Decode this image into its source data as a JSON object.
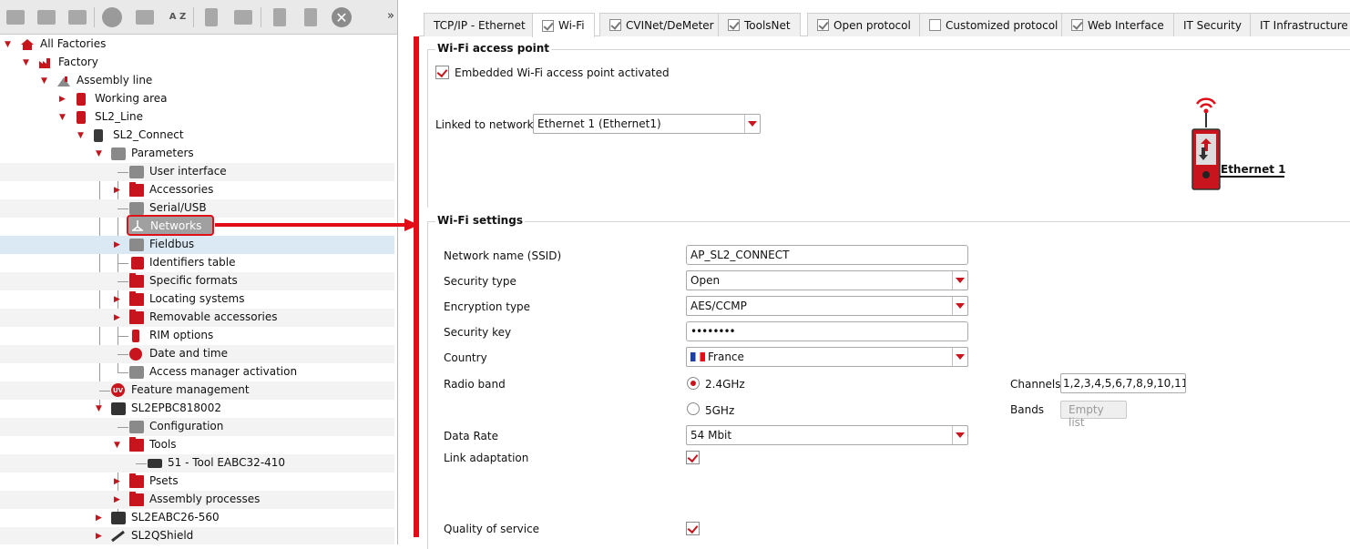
{
  "toolbar": {
    "more": "»",
    "icons": [
      "add-icon",
      "add-icon",
      "add-icon",
      "device-icon",
      "copy-device-icon",
      "sort-az-icon",
      "tool-icon",
      "export-icon",
      "copy-icon",
      "paste-icon",
      "delete-icon"
    ],
    "sort_label": "A Z"
  },
  "tree": {
    "items": [
      {
        "label": "All Factories"
      },
      {
        "label": "Factory"
      },
      {
        "label": "Assembly line"
      },
      {
        "label": "Working area"
      },
      {
        "label": "SL2_Line"
      },
      {
        "label": "SL2_Connect"
      },
      {
        "label": "Parameters"
      },
      {
        "label": "User interface"
      },
      {
        "label": "Accessories"
      },
      {
        "label": "Serial/USB"
      },
      {
        "label": "Networks"
      },
      {
        "label": "Fieldbus"
      },
      {
        "label": "Identifiers table"
      },
      {
        "label": "Specific formats"
      },
      {
        "label": "Locating systems"
      },
      {
        "label": "Removable accessories"
      },
      {
        "label": "RIM options"
      },
      {
        "label": "Date and time"
      },
      {
        "label": "Access manager activation"
      },
      {
        "label": "Feature management"
      },
      {
        "label": "SL2EPBC818002"
      },
      {
        "label": "Configuration"
      },
      {
        "label": "Tools"
      },
      {
        "label": "51 - Tool EABC32-410"
      },
      {
        "label": "Psets"
      },
      {
        "label": "Assembly processes"
      },
      {
        "label": "SL2EABC26-560"
      },
      {
        "label": "SL2QShield"
      }
    ],
    "uv_badge": "UV"
  },
  "tabs": [
    {
      "label": "TCP/IP - Ethernet"
    },
    {
      "label": "Wi-Fi"
    },
    {
      "label": "CVINet/DeMeter"
    },
    {
      "label": "ToolsNet"
    },
    {
      "label": "Open protocol"
    },
    {
      "label": "Customized protocol"
    },
    {
      "label": "Web Interface"
    },
    {
      "label": "IT Security"
    },
    {
      "label": "IT Infrastructure"
    }
  ],
  "access_point": {
    "title": "Wi-Fi access point",
    "embedded_label": "Embedded Wi-Fi access point activated",
    "linked_label": "Linked to network",
    "linked_value": "Ethernet 1 (Ethernet1)",
    "diagram_label": "Ethernet 1"
  },
  "settings": {
    "title": "Wi-Fi settings",
    "ssid_label": "Network name (SSID)",
    "ssid_value": "AP_SL2_CONNECT",
    "security_type_label": "Security  type",
    "security_type_value": "Open",
    "encryption_label": "Encryption type",
    "encryption_value": "AES/CCMP",
    "key_label": "Security key",
    "key_value": "••••••••",
    "country_label": "Country",
    "country_value": "France",
    "radio_label": "Radio band",
    "band_24": "2.4GHz",
    "band_5": "5GHz",
    "channels_label": "Channels",
    "channels_value": "1,2,3,4,5,6,7,8,9,10,11",
    "bands_label": "Bands",
    "bands_button": "Empty list",
    "data_rate_label": "Data Rate",
    "data_rate_value": "54 Mbit",
    "link_adapt_label": "Link adaptation",
    "qos_label": "Quality of service"
  },
  "colors": {
    "accent": "#c8141c",
    "highlight": "#e30d18",
    "selected_row": "#dbe9f5"
  }
}
